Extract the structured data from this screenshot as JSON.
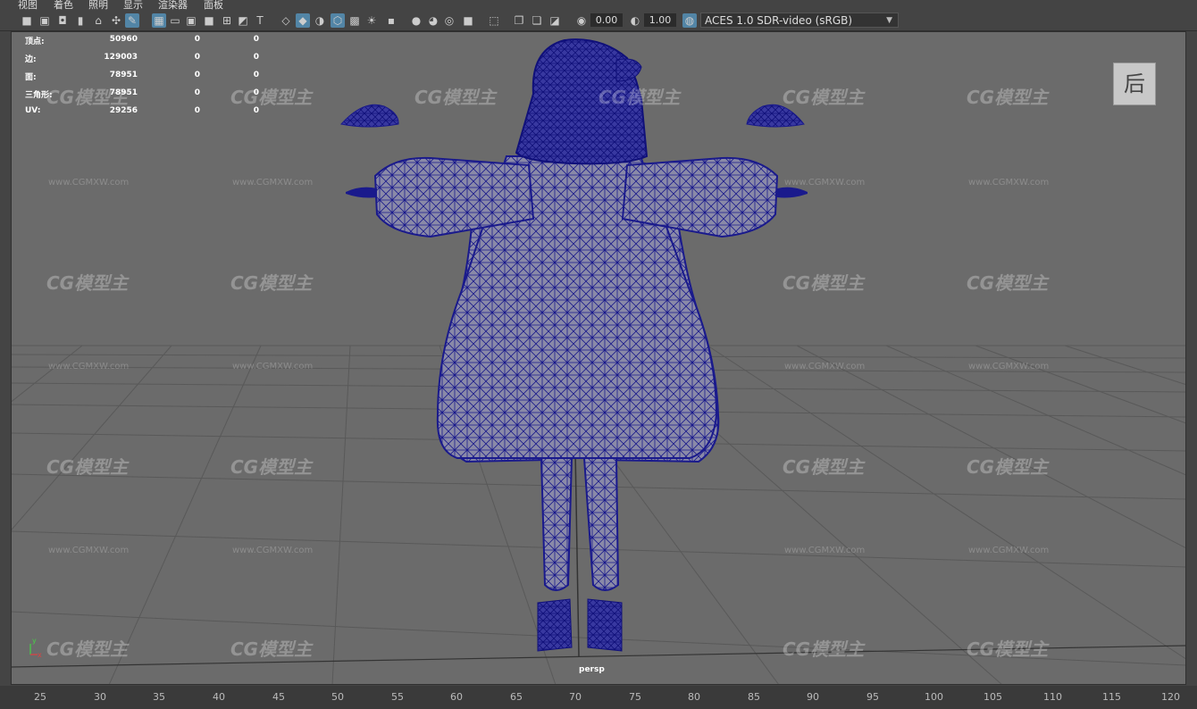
{
  "menubar": {
    "items": [
      "视图",
      "着色",
      "照明",
      "显示",
      "渲染器",
      "面板"
    ]
  },
  "toolbar": {
    "exposure_value": "0.00",
    "gamma_value": "1.00",
    "color_space": "ACES 1.0 SDR-video (sRGB)"
  },
  "hud": {
    "rows": [
      {
        "label": "顶点:",
        "v1": "50960",
        "v2": "0",
        "v3": "0"
      },
      {
        "label": "边:",
        "v1": "129003",
        "v2": "0",
        "v3": "0"
      },
      {
        "label": "面:",
        "v1": "78951",
        "v2": "0",
        "v3": "0"
      },
      {
        "label": "三角形:",
        "v1": "78951",
        "v2": "0",
        "v3": "0"
      },
      {
        "label": "UV:",
        "v1": "29256",
        "v2": "0",
        "v3": "0"
      }
    ]
  },
  "viewcube": {
    "label": "后"
  },
  "viewport": {
    "camera_label": "persp"
  },
  "axis": {
    "y": "y",
    "x": "x"
  },
  "timeline": {
    "ticks": [
      "25",
      "30",
      "35",
      "40",
      "45",
      "50",
      "55",
      "60",
      "65",
      "70",
      "75",
      "80",
      "85",
      "90",
      "95",
      "100",
      "105",
      "110",
      "115",
      "120"
    ]
  },
  "watermark": {
    "logo_text": "CG模型主",
    "url_text": "www.CGMXW.com"
  },
  "colors": {
    "viewport_bg": "#6b6b6b",
    "wireframe": "#1a1a8c",
    "active_button": "#5285a6",
    "ui_bg": "#444444"
  }
}
